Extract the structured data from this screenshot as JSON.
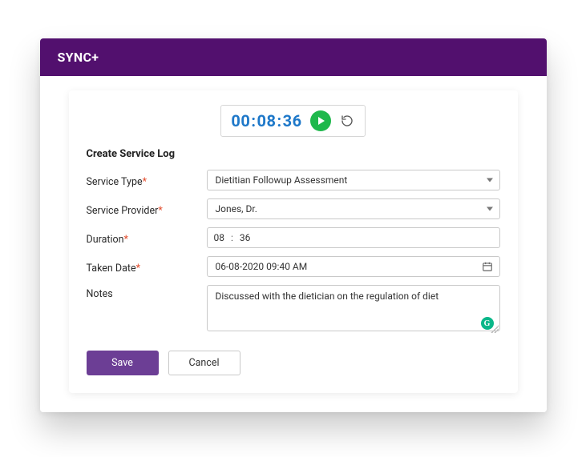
{
  "header": {
    "title": "SYNC+"
  },
  "timer": {
    "hours": "00",
    "minutes": "08",
    "seconds": "36"
  },
  "form": {
    "title": "Create Service Log",
    "labels": {
      "service_type": "Service Type",
      "service_provider": "Service Provider",
      "duration": "Duration",
      "taken_date": "Taken Date",
      "notes": "Notes"
    },
    "required_mark": "*",
    "values": {
      "service_type": "Dietitian Followup Assessment",
      "service_provider": "Jones, Dr.",
      "duration_minutes": "08",
      "duration_seconds": "36",
      "duration_sep": ":",
      "taken_date": "06-08-2020 09:40 AM",
      "notes": "Discussed with the dietician on the regulation of diet"
    }
  },
  "buttons": {
    "save": "Save",
    "cancel": "Cancel"
  },
  "badge": {
    "grammar": "G"
  }
}
